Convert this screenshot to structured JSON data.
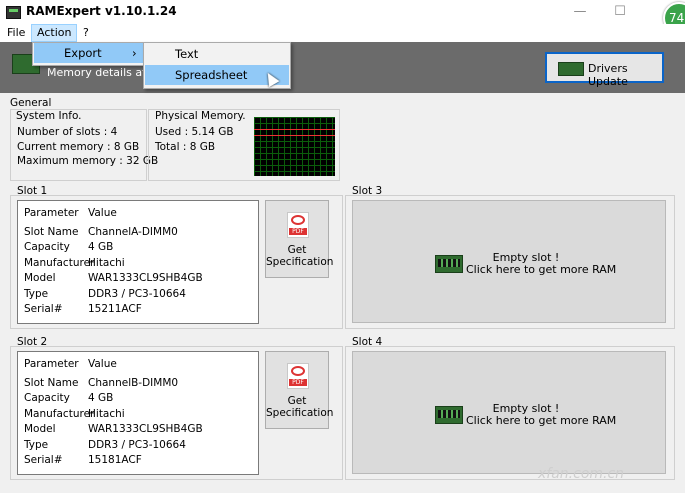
{
  "window": {
    "title": "RAMExpert v1.10.1.24",
    "badge": "74"
  },
  "menu": {
    "file": "File",
    "action": "Action",
    "help": "?"
  },
  "action_menu": {
    "export": "Export",
    "export_arrow": "›"
  },
  "export_menu": {
    "text": "Text",
    "spreadsheet": "Spreadsheet"
  },
  "banner": {
    "description": "Memory details at you",
    "drivers_update": "Drivers Update"
  },
  "general": {
    "label": "General",
    "system_info": {
      "label": "System Info.",
      "slots": "Number of slots : 4",
      "current": "Current memory : 8 GB",
      "maximum": "Maximum memory : 32 GB"
    },
    "physical_memory": {
      "label": "Physical Memory.",
      "used": "Used : 5.14 GB",
      "total": "Total : 8 GB"
    }
  },
  "slots": [
    {
      "label": "Slot 1",
      "headers": [
        "Parameter",
        "Value"
      ],
      "rows": [
        [
          "Slot Name",
          "ChannelA-DIMM0"
        ],
        [
          "Capacity",
          "4 GB"
        ],
        [
          "Manufacturer",
          "Hitachi"
        ],
        [
          "Model",
          "WAR1333CL9SHB4GB"
        ],
        [
          "Type",
          "DDR3 / PC3-10664"
        ],
        [
          "Serial#",
          "15211ACF"
        ]
      ],
      "spec_line1": "Get",
      "spec_line2": "Specification"
    },
    {
      "label": "Slot 2",
      "headers": [
        "Parameter",
        "Value"
      ],
      "rows": [
        [
          "Slot Name",
          "ChannelB-DIMM0"
        ],
        [
          "Capacity",
          "4 GB"
        ],
        [
          "Manufacturer",
          "Hitachi"
        ],
        [
          "Model",
          "WAR1333CL9SHB4GB"
        ],
        [
          "Type",
          "DDR3 / PC3-10664"
        ],
        [
          "Serial#",
          "15181ACF"
        ]
      ],
      "spec_line1": "Get",
      "spec_line2": "Specification"
    },
    {
      "label": "Slot 3",
      "empty_line1": "Empty slot !",
      "empty_line2": "Click here to get more RAM"
    },
    {
      "label": "Slot 4",
      "empty_line1": "Empty slot !",
      "empty_line2": "Click here to get more RAM"
    }
  ],
  "pdf_label": "PDF",
  "watermark": "xfan.com.cn"
}
